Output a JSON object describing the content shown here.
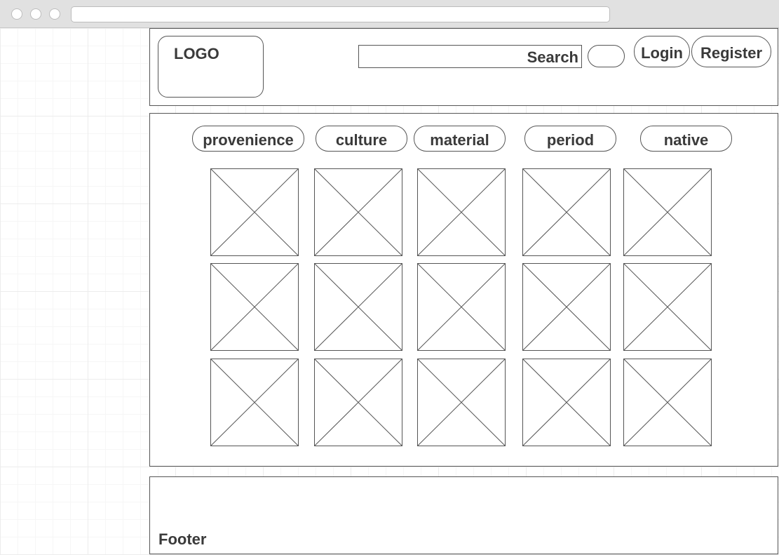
{
  "header": {
    "logo_label": "LOGO",
    "search_label": "Search",
    "login_label": "Login",
    "register_label": "Register"
  },
  "filters": [
    {
      "label": "provenience"
    },
    {
      "label": "culture"
    },
    {
      "label": "material"
    },
    {
      "label": "period"
    },
    {
      "label": "native"
    }
  ],
  "gallery": {
    "placeholder_icon": "image-placeholder-icon"
  },
  "footer": {
    "label": "Footer"
  }
}
